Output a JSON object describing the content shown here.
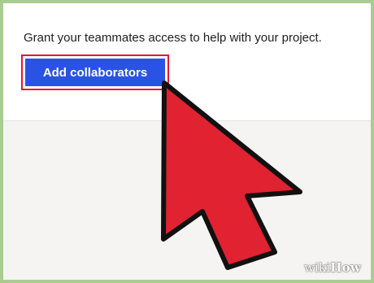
{
  "main": {
    "description": "Grant your teammates access to help with your project.",
    "add_collaborators_label": "Add collaborators"
  },
  "cursor": {
    "icon": "arrow-cursor-icon",
    "fill_color": "#e02231",
    "outline_color": "#111111"
  },
  "watermark": {
    "wiki": "wiki",
    "how": "How"
  },
  "colors": {
    "frame_border": "#a9cc8f",
    "button_fill": "#2a53e6",
    "button_highlight": "#e4182f"
  }
}
